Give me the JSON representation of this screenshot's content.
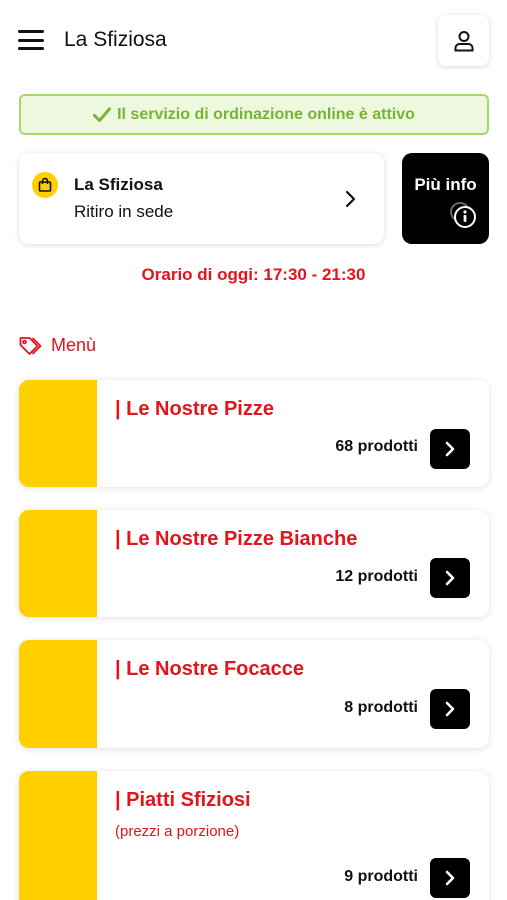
{
  "header": {
    "menu_icon": "hamburger-icon",
    "title": "La Sfiziosa",
    "user_icon": "user-icon"
  },
  "service_banner": {
    "icon": "check-icon",
    "text": "Il servizio di ordinazione online è attivo",
    "color": "#74b534"
  },
  "store": {
    "icon": "shopping-bag-icon",
    "name": "La Sfiziosa",
    "mode": "Ritiro in sede",
    "chevron_icon": "chevron-right-icon"
  },
  "info_button": {
    "label": "Più info",
    "icon": "info-icon"
  },
  "hours": {
    "text": "Orario di oggi: 17:30 - 21:30"
  },
  "menu": {
    "icon": "tags-icon",
    "label": "Menù",
    "categories": [
      {
        "title": "| Le Nostre Pizze",
        "subtitle": "",
        "count": "68 prodotti"
      },
      {
        "title": "| Le Nostre Pizze Bianche",
        "subtitle": "",
        "count": "12 prodotti"
      },
      {
        "title": "| Le Nostre Focacce",
        "subtitle": "",
        "count": "8 prodotti"
      },
      {
        "title": "| Piatti Sfiziosi",
        "subtitle": "(prezzi a porzione)",
        "count": "9 prodotti"
      }
    ]
  },
  "colors": {
    "accent_red": "#e3141b",
    "category_yellow": "#ffcf00",
    "banner_bg": "#eef8de",
    "banner_border": "#a5d86b"
  }
}
